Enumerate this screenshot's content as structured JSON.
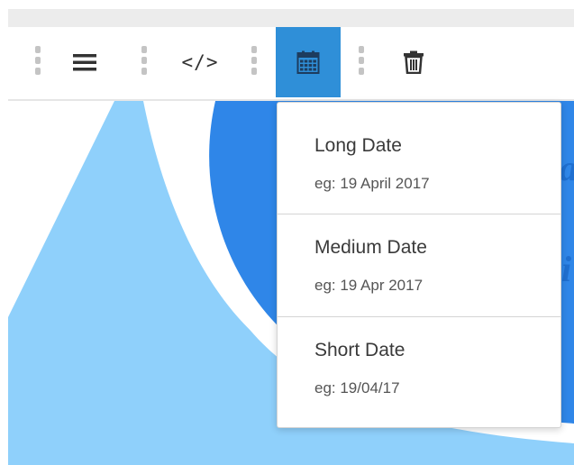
{
  "toolbar": {
    "buttons": [
      {
        "name": "align-menu-button",
        "icon": "hamburger-icon"
      },
      {
        "name": "code-button",
        "icon": "code-icon",
        "label": "</>"
      },
      {
        "name": "date-format-button",
        "icon": "calendar-icon",
        "active": true
      },
      {
        "name": "delete-button",
        "icon": "trash-icon"
      }
    ],
    "active_color": "#2f8fd8"
  },
  "dropdown": {
    "items": [
      {
        "title": "Long Date",
        "example": "eg: 19 April 2017"
      },
      {
        "title": "Medium Date",
        "example": "eg: 19 Apr 2017"
      },
      {
        "title": "Short Date",
        "example": "eg: 19/04/17"
      }
    ]
  },
  "colors": {
    "light_blue": "#8fd0fb",
    "blue": "#2f86e8"
  }
}
